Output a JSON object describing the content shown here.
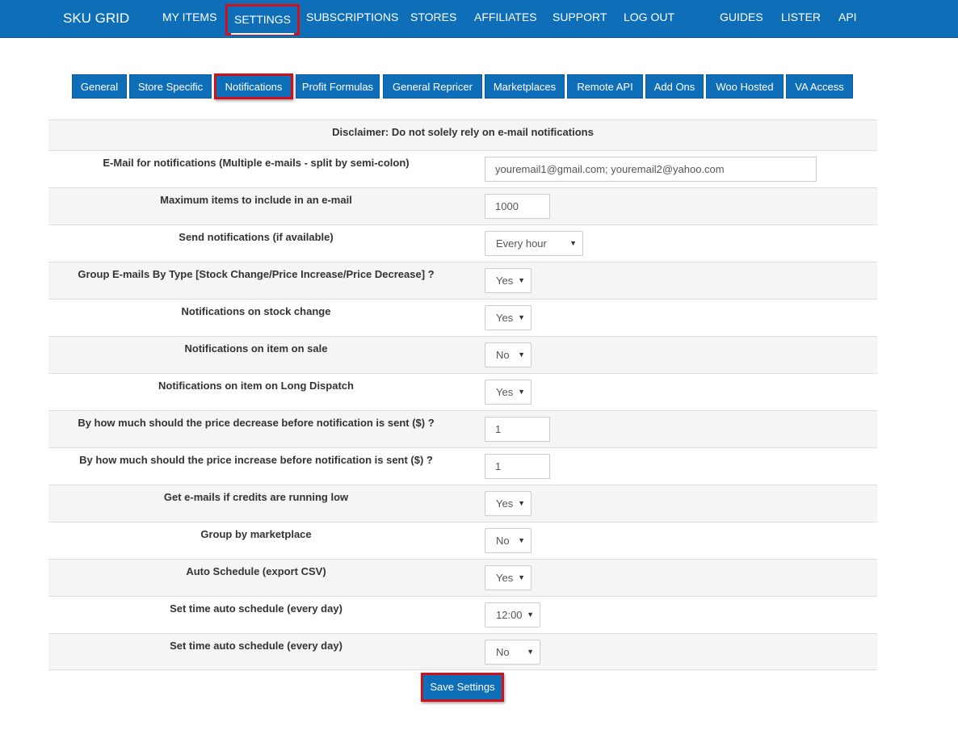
{
  "brand": "SKU GRID",
  "nav": {
    "my_items": "MY ITEMS",
    "settings": "SETTINGS",
    "subscriptions": "SUBSCRIPTIONS",
    "stores": "STORES",
    "affiliates": "AFFILIATES",
    "support": "SUPPORT",
    "logout": "LOG OUT",
    "guides": "GUIDES",
    "lister": "LISTER",
    "api": "API"
  },
  "tabs": {
    "general": "General",
    "store_specific": "Store Specific",
    "notifications": "Notifications",
    "profit_formulas": "Profit Formulas",
    "general_repricer": "General Repricer",
    "marketplaces": "Marketplaces",
    "remote_api": "Remote API",
    "add_ons": "Add Ons",
    "woo_hosted": "Woo Hosted",
    "va_access": "VA Access"
  },
  "disclaimer": "Disclaimer: Do not solely rely on e-mail notifications",
  "rows": [
    {
      "label": "E-Mail for notifications (Multiple e-mails - split by semi-colon)",
      "value": "youremail1@gmail.com; youremail2@yahoo.com"
    },
    {
      "label": "Maximum items to include in an e-mail",
      "value": "1000"
    },
    {
      "label": "Send notifications (if available)",
      "value": "Every hour"
    },
    {
      "label": "Group E-mails By Type [Stock Change/Price Increase/Price Decrease] ?",
      "value": "Yes"
    },
    {
      "label": "Notifications on stock change",
      "value": "Yes"
    },
    {
      "label": "Notifications on item on sale",
      "value": "No"
    },
    {
      "label": "Notifications on item on Long Dispatch",
      "value": "Yes"
    },
    {
      "label": "By how much should the price decrease before notification is sent ($) ?",
      "value": "1"
    },
    {
      "label": "By how much should the price increase before notification is sent ($) ?",
      "value": "1"
    },
    {
      "label": "Get e-mails if credits are running low",
      "value": "Yes"
    },
    {
      "label": "Group by marketplace",
      "value": "No"
    },
    {
      "label": "Auto Schedule (export CSV)",
      "value": "Yes"
    },
    {
      "label": "Set time auto schedule (every day)",
      "value": "12:00"
    },
    {
      "label": "Set time auto schedule (every day)",
      "value": "No"
    }
  ],
  "save_label": "Save Settings",
  "colors": {
    "primary": "#0e6fb8",
    "highlight": "#d0101a",
    "row_alt": "#f5f5f5"
  }
}
